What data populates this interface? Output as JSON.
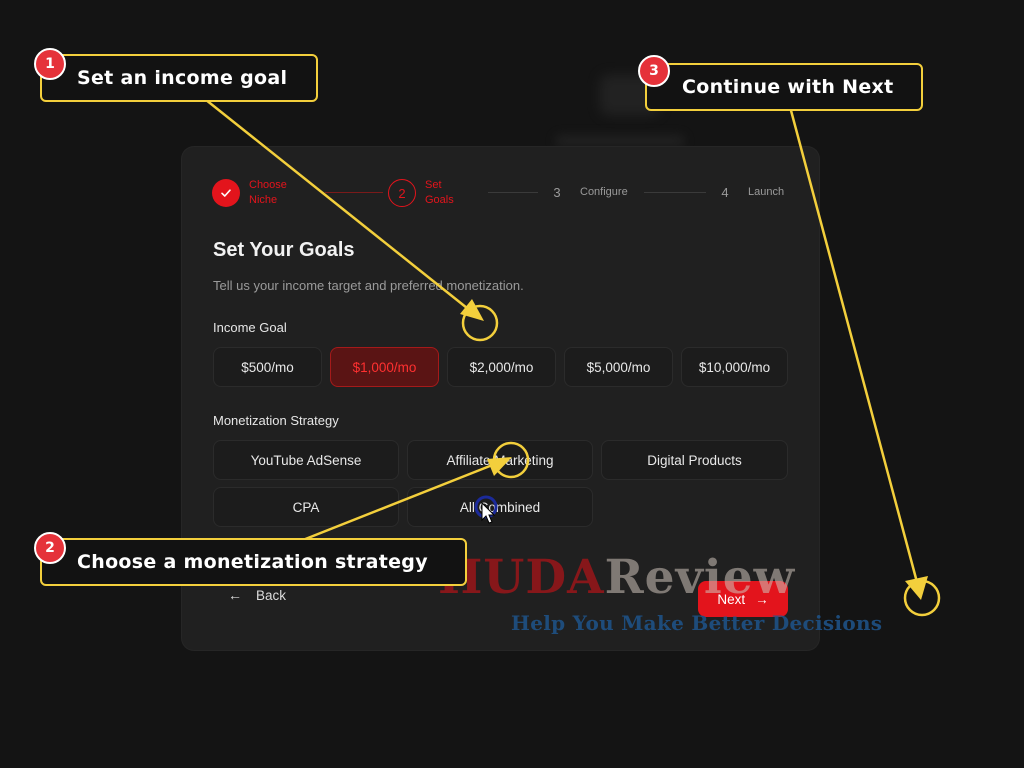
{
  "stepper": [
    {
      "number": "✓",
      "label_line1": "Choose",
      "label_line2": "Niche",
      "state": "done"
    },
    {
      "number": "2",
      "label_line1": "Set",
      "label_line2": "Goals",
      "state": "active"
    },
    {
      "number": "3",
      "label": "Configure",
      "state": "todo"
    },
    {
      "number": "4",
      "label": "Launch",
      "state": "todo"
    }
  ],
  "page": {
    "title": "Set Your Goals",
    "subtitle": "Tell us your income target and preferred monetization."
  },
  "income_goal": {
    "label": "Income Goal",
    "options": [
      "$500/mo",
      "$1,000/mo",
      "$2,000/mo",
      "$5,000/mo",
      "$10,000/mo"
    ],
    "selected": "$1,000/mo"
  },
  "monetization": {
    "label": "Monetization Strategy",
    "options": [
      "YouTube AdSense",
      "Affiliate Marketing",
      "Digital Products",
      "CPA",
      "All Combined"
    ]
  },
  "footer": {
    "back_label": "Back",
    "next_label": "Next",
    "back_icon": "arrow-left-icon",
    "next_icon": "arrow-right-icon"
  },
  "annotations": [
    {
      "number": "1",
      "text": "Set an income goal"
    },
    {
      "number": "2",
      "text": "Choose a monetization strategy"
    },
    {
      "number": "3",
      "text": "Continue with Next"
    }
  ],
  "watermark": {
    "brand_part1": "HUDA",
    "brand_part2": "Review",
    "tagline": "Help You Make Better Decisions"
  },
  "colors": {
    "accent": "#e3141c",
    "annotation": "#f3cf3c",
    "background": "#141414",
    "card": "#202020"
  }
}
